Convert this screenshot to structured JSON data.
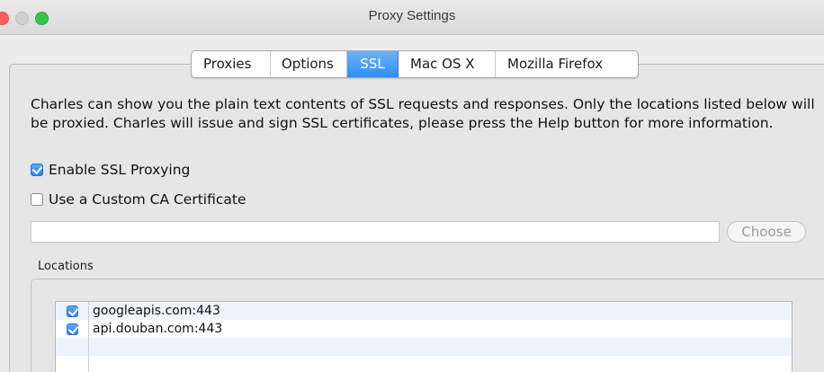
{
  "window": {
    "title": "Proxy Settings"
  },
  "tabs": [
    {
      "label": "Proxies",
      "active": false
    },
    {
      "label": "Options",
      "active": false
    },
    {
      "label": "SSL",
      "active": true
    },
    {
      "label": "Mac OS X",
      "active": false
    },
    {
      "label": "Mozilla Firefox",
      "active": false
    }
  ],
  "ssl": {
    "description": "Charles can show you the plain text contents of SSL requests and responses. Only the locations listed below will be proxied. Charles will issue and sign SSL certificates, please press the Help button for more information.",
    "enable_ssl_proxying": {
      "label": "Enable SSL Proxying",
      "checked": true
    },
    "custom_ca": {
      "label": "Use a Custom CA Certificate",
      "checked": false
    },
    "cert_path_value": "",
    "choose_label": "Choose",
    "locations_label": "Locations",
    "locations": [
      {
        "host": "googleapis.com:443",
        "enabled": true
      },
      {
        "host": "api.douban.com:443",
        "enabled": true
      }
    ]
  },
  "colors": {
    "accent": "#2f8ef5",
    "close": "#fc615d",
    "maximize": "#34c84a"
  }
}
